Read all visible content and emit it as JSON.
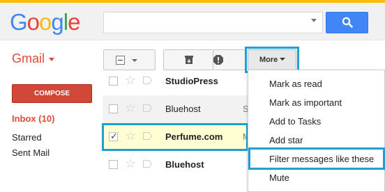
{
  "header": {
    "logo_letters": [
      {
        "ch": "G",
        "color": "#4285f4"
      },
      {
        "ch": "o",
        "color": "#ea4335"
      },
      {
        "ch": "o",
        "color": "#fbbc05"
      },
      {
        "ch": "g",
        "color": "#4285f4"
      },
      {
        "ch": "l",
        "color": "#34a853"
      },
      {
        "ch": "e",
        "color": "#ea4335"
      }
    ],
    "search_value": "",
    "accent_color": "#fbbc05",
    "search_button_color": "#4285f4"
  },
  "app": {
    "name": "Gmail",
    "color": "#dd4b39"
  },
  "toolbar": {
    "more_label": "More",
    "highlight_color": "#1ea0d5"
  },
  "sidebar": {
    "compose_label": "COMPOSE",
    "items": [
      {
        "label": "Inbox (10)",
        "active": true
      },
      {
        "label": "Starred"
      },
      {
        "label": "Sent Mail"
      }
    ]
  },
  "messages": [
    {
      "sender": "StudioPress",
      "bold": true,
      "checked": false
    },
    {
      "sender": "Bluehost",
      "bold": false,
      "checked": false,
      "trail": "S"
    },
    {
      "sender": "Perfume.com",
      "bold": true,
      "checked": true,
      "trail": "M"
    },
    {
      "sender": "Bluehost",
      "bold": true,
      "checked": false
    }
  ],
  "more_menu": {
    "items": [
      "Mark as read",
      "Mark as important",
      "Add to Tasks",
      "Add star",
      "Filter messages like these",
      "Mute"
    ],
    "highlighted_index": 4
  }
}
